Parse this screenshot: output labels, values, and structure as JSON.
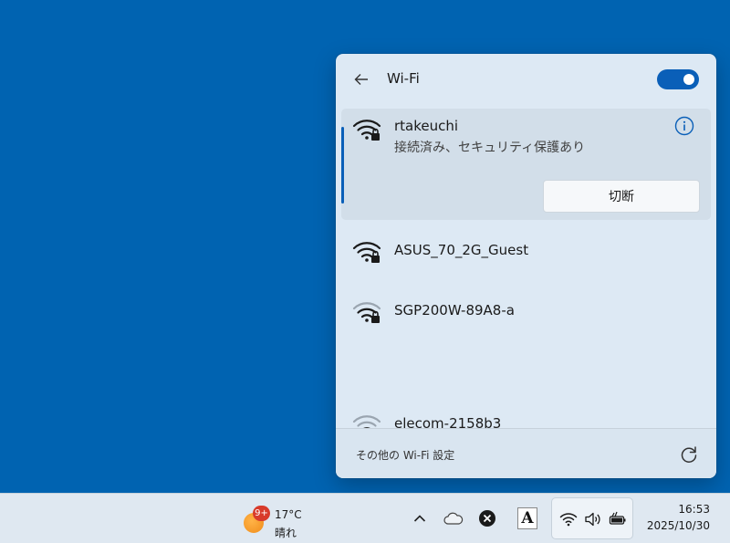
{
  "flyout": {
    "title": "Wi-Fi",
    "wifi_enabled": true,
    "networks": [
      {
        "ssid": "rtakeuchi",
        "status": "接続済み、セキュリティ保護あり",
        "action": "切断",
        "secured": true,
        "connected": true,
        "signal": "full"
      },
      {
        "ssid": "ASUS_70_2G_Guest",
        "secured": true,
        "signal": "full"
      },
      {
        "ssid": "SGP200W-89A8-a",
        "secured": true,
        "signal": "medium"
      },
      {
        "ssid": "elecom-2158b3",
        "secured": true,
        "signal": "low"
      }
    ],
    "more_settings": "その他の Wi-Fi 設定"
  },
  "taskbar": {
    "weather": {
      "badge": "9+",
      "temperature": "17°C",
      "condition": "晴れ"
    },
    "clock": {
      "time": "16:53",
      "date": "2025/10/30"
    },
    "tray_icons": [
      "chevron-up-icon",
      "onedrive-icon",
      "close-circle-icon",
      "font-a-icon",
      "wifi-icon",
      "volume-icon",
      "battery-icon"
    ]
  },
  "colors": {
    "desktop": "#0063b1",
    "accent": "#0a5fb8",
    "flyout_bg": "#dde9f4"
  }
}
